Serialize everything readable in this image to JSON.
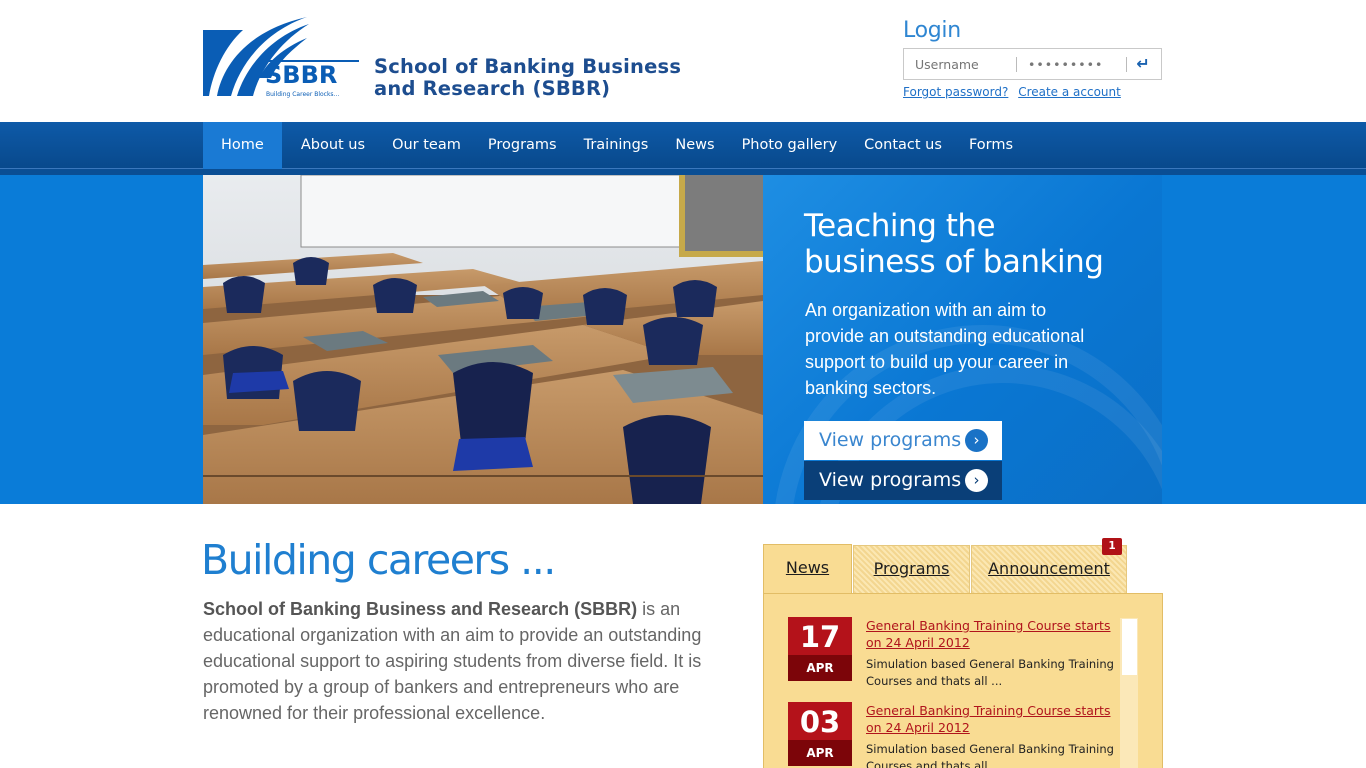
{
  "header": {
    "logo_line1": "School of Banking Business",
    "logo_line2": "and Research (SBBR)",
    "logo_mark": "SBBR",
    "logo_tagline": "Building Career Blocks..."
  },
  "login": {
    "title": "Login",
    "username_placeholder": "Username",
    "password_value": "•••••••••",
    "submit_icon": "enter-arrow-icon",
    "forgot_label": "Forgot password?",
    "create_label": "Create a account"
  },
  "nav": {
    "items": [
      {
        "label": "Home"
      },
      {
        "label": "About us"
      },
      {
        "label": "Our team"
      },
      {
        "label": "Programs"
      },
      {
        "label": "Trainings"
      },
      {
        "label": "News"
      },
      {
        "label": "Photo gallery"
      },
      {
        "label": "Contact us"
      },
      {
        "label": "Forms"
      }
    ]
  },
  "hero": {
    "title_line1": "Teaching the",
    "title_line2": "business of banking",
    "text": "An organization with an aim to provide an outstanding educational support to build up your career in banking sectors.",
    "button1_label": "View programs",
    "button2_label": "View programs"
  },
  "intro": {
    "title": "Building careers ...",
    "bold": "School of Banking Business and Research (SBBR)",
    "text": " is an educational organization with an aim to provide an outstanding educational support to aspiring students from diverse field. It is promoted by a group of bankers and entrepreneurs who are renowned for their professional excellence."
  },
  "tabs": {
    "news": "News",
    "programs": "Programs",
    "announcement": "Announcement",
    "announcement_badge": "1"
  },
  "news": [
    {
      "day": "17",
      "month": "APR",
      "title": "General Banking Training Course starts on 24 April 2012",
      "desc": "Simulation based General Banking Training Courses and thats all ..."
    },
    {
      "day": "03",
      "month": "APR",
      "title": "General Banking Training Course starts on 24 April 2012",
      "desc": "Simulation based General Banking Training Courses and thats all ..."
    }
  ],
  "colors": {
    "brand_blue": "#0a7cd8",
    "nav_blue": "#0e5aa8",
    "accent_red": "#b4121a",
    "panel_yellow": "#f9dc93"
  }
}
